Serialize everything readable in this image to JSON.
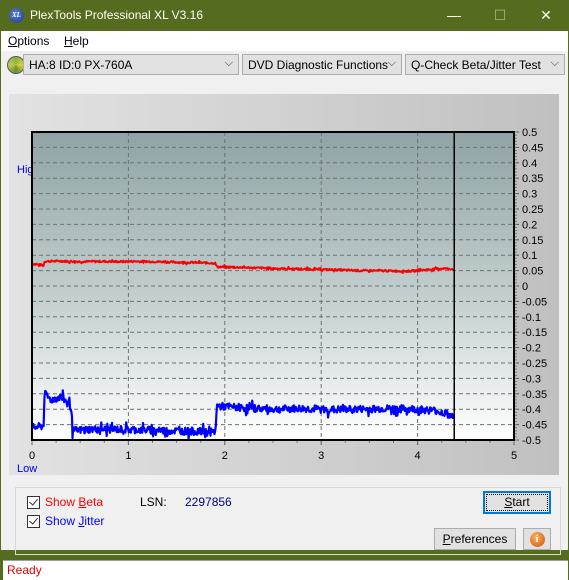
{
  "window": {
    "title": "PlexTools Professional XL V3.16",
    "icon": "xl-logo-icon",
    "app_icon_text": "XL",
    "controls": {
      "minimize": "—",
      "maximize": "☐",
      "close": "✕"
    }
  },
  "menu": {
    "items": [
      {
        "label": "Options",
        "mnemonic": "O",
        "rest": "ptions"
      },
      {
        "label": "Help",
        "mnemonic": "H",
        "rest": "elp"
      }
    ]
  },
  "toolbar": {
    "drive_select": "HA:8 ID:0  PX-760A",
    "function_select": "DVD Diagnostic Functions",
    "test_select": "Q-Check Beta/Jitter Test",
    "dropdown_glyph": "⌵"
  },
  "chart_labels": {
    "high": "High",
    "low": "Low"
  },
  "chart_data": {
    "type": "line",
    "title": "",
    "xlabel": "",
    "ylabel": "",
    "xlim": [
      0,
      5
    ],
    "ylim": [
      -0.5,
      0.5
    ],
    "x_ticks": [
      "0",
      "1",
      "2",
      "3",
      "4",
      "5"
    ],
    "y_ticks": [
      "0.5",
      "0.45",
      "0.4",
      "0.35",
      "0.3",
      "0.25",
      "0.2",
      "0.15",
      "0.1",
      "0.05",
      "0",
      "-0.05",
      "-0.1",
      "-0.15",
      "-0.2",
      "-0.25",
      "-0.3",
      "-0.35",
      "-0.4",
      "-0.45",
      "-0.5"
    ],
    "grid": true,
    "end_marker_x": 4.38,
    "series": [
      {
        "name": "Beta",
        "color": "#ff0000",
        "points": [
          [
            0,
            0.072
          ],
          [
            0.1,
            0.068
          ],
          [
            0.12,
            0.066
          ],
          [
            0.13,
            0.08
          ],
          [
            0.3,
            0.081
          ],
          [
            0.5,
            0.079
          ],
          [
            0.7,
            0.08
          ],
          [
            0.9,
            0.079
          ],
          [
            1.1,
            0.08
          ],
          [
            1.3,
            0.079
          ],
          [
            1.5,
            0.077
          ],
          [
            1.7,
            0.076
          ],
          [
            1.9,
            0.074
          ],
          [
            1.92,
            0.062
          ],
          [
            2.2,
            0.06
          ],
          [
            2.5,
            0.057
          ],
          [
            2.8,
            0.055
          ],
          [
            3.1,
            0.053
          ],
          [
            3.4,
            0.05
          ],
          [
            3.7,
            0.049
          ],
          [
            3.9,
            0.048
          ],
          [
            4.0,
            0.05
          ],
          [
            4.1,
            0.053
          ],
          [
            4.25,
            0.057
          ],
          [
            4.38,
            0.055
          ]
        ]
      },
      {
        "name": "Jitter",
        "color": "#0000ff",
        "points": [
          [
            0,
            -0.46
          ],
          [
            0.12,
            -0.455
          ],
          [
            0.13,
            -0.35
          ],
          [
            0.2,
            -0.37
          ],
          [
            0.3,
            -0.36
          ],
          [
            0.38,
            -0.38
          ],
          [
            0.41,
            -0.4
          ],
          [
            0.42,
            -0.47
          ],
          [
            0.6,
            -0.465
          ],
          [
            0.9,
            -0.465
          ],
          [
            1.2,
            -0.468
          ],
          [
            1.5,
            -0.47
          ],
          [
            1.7,
            -0.472
          ],
          [
            1.9,
            -0.475
          ],
          [
            1.92,
            -0.39
          ],
          [
            2.2,
            -0.395
          ],
          [
            2.5,
            -0.4
          ],
          [
            2.8,
            -0.398
          ],
          [
            3.1,
            -0.402
          ],
          [
            3.4,
            -0.4
          ],
          [
            3.7,
            -0.398
          ],
          [
            4.0,
            -0.4
          ],
          [
            4.2,
            -0.405
          ],
          [
            4.3,
            -0.415
          ],
          [
            4.38,
            -0.43
          ]
        ]
      }
    ],
    "legend": "none"
  },
  "controls": {
    "show_beta": {
      "label": "Show Beta",
      "pre": "Show ",
      "mnemonic": "B",
      "rest": "eta",
      "checked": true,
      "color": "#ff0000"
    },
    "show_jitter": {
      "label": "Show Jitter",
      "pre": "Show ",
      "mnemonic": "J",
      "rest": "itter",
      "checked": true,
      "color": "#0000ff"
    },
    "lsn_label": "LSN:",
    "lsn_value": "2297856",
    "start_button": {
      "mnemonic": "S",
      "rest": "tart"
    },
    "preferences_button": {
      "mnemonic": "P",
      "rest": "references"
    },
    "info_glyph": "i"
  },
  "status": {
    "text": "Ready"
  }
}
